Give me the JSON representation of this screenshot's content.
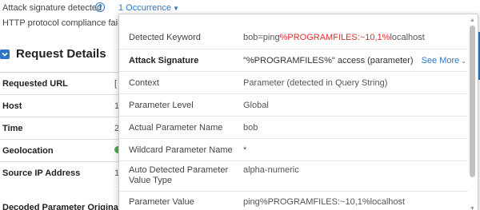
{
  "violations": {
    "attack_signature": "Attack signature detected",
    "http_compliance": "HTTP protocol compliance failed",
    "occurrence_link": "1 Occurrence",
    "help_glyph": "?"
  },
  "request_details": {
    "title": "Request Details",
    "rows": [
      {
        "label": "Requested URL",
        "value": "["
      },
      {
        "label": "Host",
        "value": "1"
      },
      {
        "label": "Time",
        "value": "2"
      },
      {
        "label": "Geolocation",
        "value": ""
      },
      {
        "label": "Source IP Address",
        "value": "1"
      }
    ],
    "bottom_text": "Decoded Parameter   Original Parameter   Parameter (MAIN)"
  },
  "popup": {
    "rows": [
      {
        "key": "Detected Keyword",
        "value_prefix": "bob=ping",
        "value_highlight": "%PROGRAMFILES:~10,1%",
        "value_suffix": "localhost"
      },
      {
        "key": "Attack Signature",
        "value": "\"%PROGRAMFILES%\" access (parameter)",
        "see_more": "See More"
      },
      {
        "key": "Context",
        "value": "Parameter (detected in Query String)"
      },
      {
        "key": "Parameter Level",
        "value": "Global"
      },
      {
        "key": "Actual Parameter Name",
        "value": "bob"
      },
      {
        "key": "Wildcard Parameter Name",
        "value": "*"
      },
      {
        "key": "Auto Detected Parameter Value Type",
        "value": "alpha-numeric"
      },
      {
        "key": "Parameter Value",
        "value": "ping%PROGRAMFILES:~10,1%localhost"
      }
    ]
  },
  "colors": {
    "accent": "#2f76c2",
    "highlight": "#d9302e"
  }
}
